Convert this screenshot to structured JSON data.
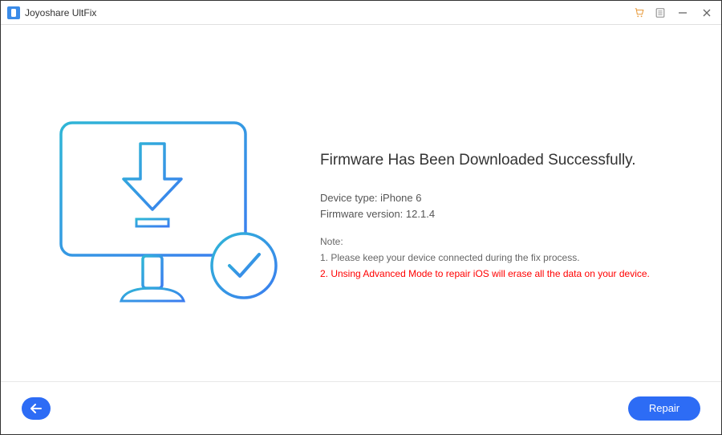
{
  "titlebar": {
    "app_name": "Joyoshare UltFix"
  },
  "main": {
    "headline": "Firmware Has Been Downloaded Successfully.",
    "device_type_label": "Device type: ",
    "device_type_value": "iPhone 6",
    "firmware_label": "Firmware version: ",
    "firmware_value": "12.1.4",
    "note_label": "Note:",
    "note1": "1. Please keep your device connected during the fix process.",
    "note2": "2. Unsing Advanced Mode to repair iOS will erase all the data on your device."
  },
  "footer": {
    "repair_label": "Repair"
  }
}
